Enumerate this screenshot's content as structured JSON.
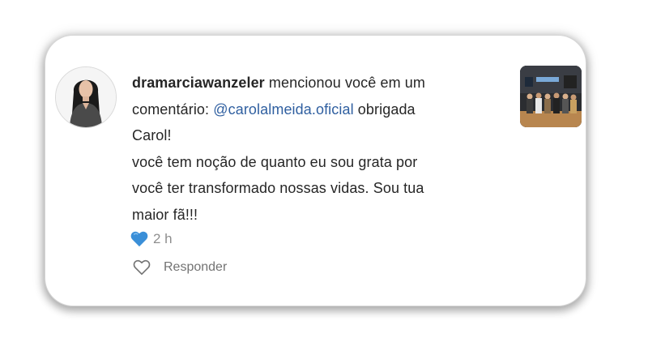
{
  "notification": {
    "username": "dramarciawanzeler",
    "text_part1": " mencionou você em um",
    "text_part2": "comentário: ",
    "mention": "@carolalmeida.oficial",
    "text_part3": " obrigada",
    "line3": "Carol!",
    "line4": " você tem noção de quanto eu sou grata por",
    "line5": "você ter transformado nossas vidas. Sou tua",
    "line6": "maior fã!!!",
    "time": "2 h",
    "reply_label": "Responder"
  },
  "icons": {
    "reaction": "blue-heart-icon",
    "like": "heart-outline-icon"
  },
  "colors": {
    "mention": "#2f5fa0",
    "reaction_heart": "#3a8fd8",
    "text": "#262626",
    "meta": "#8e8e8e"
  }
}
